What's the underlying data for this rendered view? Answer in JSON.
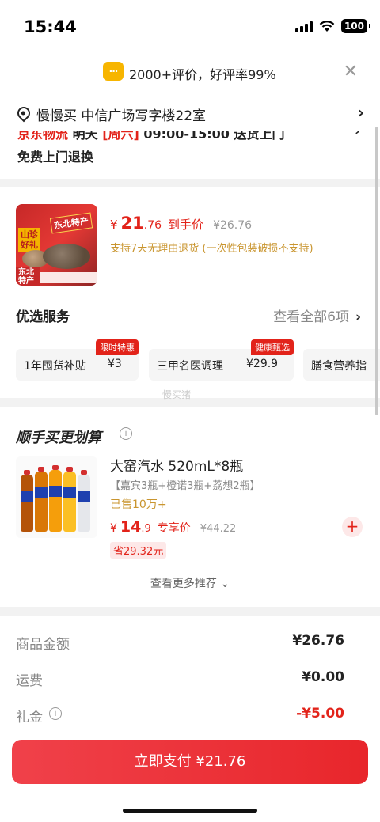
{
  "status_bar": {
    "time": "15:44",
    "battery": "100"
  },
  "header": {
    "bubble_glyph": "···",
    "rating_text": "2000+评价，好评率99%",
    "close_glyph": "✕"
  },
  "address": {
    "text": "慢慢买  中信广场写字楼22室",
    "chevron": "›"
  },
  "delivery": {
    "carrier": "京东物流",
    "day": "明天",
    "weekday": "[周六]",
    "slot": "09:00-15:00 送货上门",
    "return_policy": "免费上门退换",
    "chevron": "›"
  },
  "product": {
    "thumb_text_1": "山珍好礼",
    "thumb_text_2": "东北特产",
    "thumb_text_3": "东北特产",
    "currency": "¥",
    "price_int": "21",
    "price_dec": ".76",
    "price_tag": "到手价",
    "original_price": "¥26.76",
    "return_note": "支持7天无理由退货 (一次性包装破损不支持)"
  },
  "services": {
    "title": "优选服务",
    "view_all": "查看全部6项",
    "chevron": "›",
    "items": [
      {
        "name": "1年囤货补贴",
        "value": "¥3",
        "badge": "限时特惠"
      },
      {
        "name": "三甲名医调理",
        "value": "¥29.9",
        "badge": "健康甄选"
      },
      {
        "name": "膳食营养指",
        "value": "",
        "badge": ""
      }
    ],
    "watermark": "慢买猪"
  },
  "bundle": {
    "title": "顺手买更划算",
    "info_glyph": "i",
    "name": "大窑汽水 520mL*8瓶",
    "spec": "【嘉宾3瓶+橙诺3瓶+荔想2瓶】",
    "sold": "已售10万+",
    "currency": "¥",
    "price_int": "14",
    "price_dec": ".9",
    "price_tag": "专享价",
    "original_price": "¥44.22",
    "save": "省29.32元",
    "add_glyph": "+",
    "more": "查看更多推荐 ⌄"
  },
  "summary": {
    "rows": [
      {
        "label": "商品金额",
        "value": "¥26.76"
      },
      {
        "label": "运费",
        "value": "¥0.00"
      },
      {
        "label": "礼金",
        "value": "-¥5.00"
      }
    ],
    "info_glyph": "i",
    "pay_button": "立即支付 ¥21.76"
  },
  "colors": {
    "accent": "#e2231a",
    "gold": "#c9952f",
    "bubble": "#f7b500"
  },
  "icons": [
    "signal-icon",
    "wifi-icon",
    "battery-icon",
    "message-bubble-icon",
    "close-icon",
    "location-pin-icon",
    "chevron-right-icon",
    "info-icon",
    "plus-icon",
    "chevron-down-icon"
  ]
}
